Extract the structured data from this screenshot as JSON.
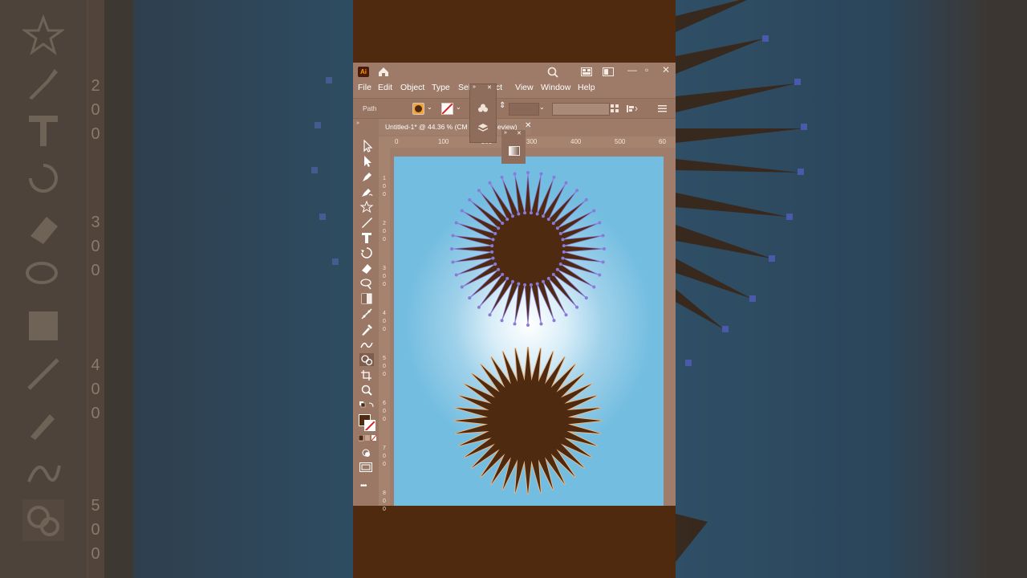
{
  "app": {
    "logo_text": "Ai",
    "menu": [
      "File",
      "Edit",
      "Object",
      "Type",
      "Sele",
      "ect",
      "View",
      "Window",
      "Help"
    ],
    "control_bar": {
      "selection_label": "Path",
      "fill_color": "#4e2a10"
    },
    "document_tab": {
      "title": "Untitled-1* @ 44.36 % (CM",
      "title_tail": "eview)"
    },
    "ruler": {
      "h_labels": [
        "0",
        "100",
        "200",
        "300",
        "400",
        "500",
        "60"
      ],
      "v_labels": [
        "1\n0\n0",
        "2\n0\n0",
        "3\n0\n0",
        "4\n0\n0",
        "5\n0\n0",
        "6\n0\n0",
        "7\n0\n0",
        "8\n0\n0"
      ]
    },
    "tools": [
      "selection-tool",
      "direct-selection-tool",
      "pen-tool",
      "curvature-tool",
      "star-tool",
      "paintbrush-tool",
      "type-tool",
      "rotate-tool",
      "eraser-tool",
      "lasso-tool",
      "gradient-tool",
      "eyedropper-tool",
      "blend-tool",
      "puppet-warp-tool",
      "shape-builder-tool",
      "artboard-tool",
      "zoom-tool"
    ],
    "more_tools": "•••"
  },
  "artwork": {
    "artboard_gradient": [
      "#ffffff",
      "#73bde0"
    ],
    "shape_color": "#4e2a10",
    "anchor_color": "#8a7ad8",
    "top_burst": {
      "points": 36,
      "selected": true
    },
    "bottom_burst": {
      "points": 36,
      "selected": false
    }
  },
  "background": {
    "left_ruler_labels": [
      "2",
      "0",
      "0",
      "3",
      "0",
      "0",
      "4",
      "0",
      "0",
      "5",
      "0",
      "0"
    ]
  }
}
